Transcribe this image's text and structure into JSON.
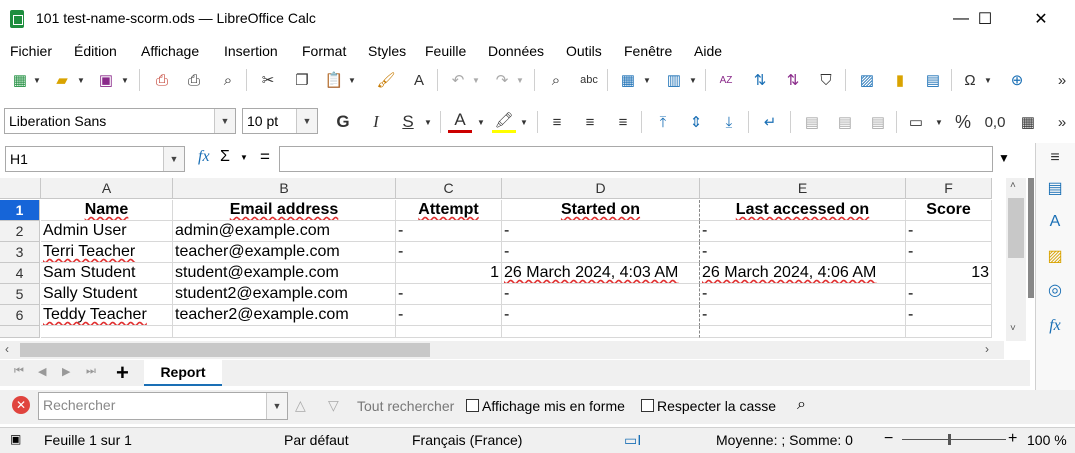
{
  "window": {
    "title": "101 test-name-scorm.ods — LibreOffice Calc",
    "minimize": "—",
    "maximize": "☐",
    "close": "✕"
  },
  "menu": [
    "Fichier",
    "Édition",
    "Affichage",
    "Insertion",
    "Format",
    "Styles",
    "Feuille",
    "Données",
    "Outils",
    "Fenêtre",
    "Aide"
  ],
  "formatting": {
    "font_name": "Liberation Sans",
    "font_size": "10 pt"
  },
  "formula_bar": {
    "name_box": "H1",
    "fx": "fx",
    "sigma": "Σ",
    "equals": "=",
    "content": ""
  },
  "sheet": {
    "columns": [
      "A",
      "B",
      "C",
      "D",
      "E",
      "F"
    ],
    "rows": [
      "1",
      "2",
      "3",
      "4",
      "5",
      "6"
    ],
    "headers": [
      "Name",
      "Email address",
      "Attempt",
      "Started on",
      "Last accessed on",
      "Score"
    ],
    "data": [
      [
        "Admin User",
        "admin@example.com",
        "-",
        "-",
        "-",
        "-"
      ],
      [
        "Terri Teacher",
        "teacher@example.com",
        "-",
        "-",
        "-",
        "-"
      ],
      [
        "Sam Student",
        "student@example.com",
        "1",
        "26 March 2024, 4:03 AM",
        "26 March 2024, 4:06 AM",
        "13"
      ],
      [
        "Sally Student",
        "student2@example.com",
        "-",
        "-",
        "-",
        "-"
      ],
      [
        "Teddy Teacher",
        "teacher2@example.com",
        "-",
        "-",
        "-",
        "-"
      ]
    ]
  },
  "tabs": {
    "add": "+",
    "active_tab": "Report"
  },
  "find": {
    "placeholder": "Rechercher",
    "find_all": "Tout rechercher",
    "formatted_display": "Affichage mis en forme",
    "match_case": "Respecter la casse"
  },
  "status": {
    "sheet": "Feuille 1 sur 1",
    "page_style": "Par défaut",
    "language": "Français (France)",
    "summary": "Moyenne: ; Somme: 0",
    "zoom_minus": "−",
    "zoom_plus": "+",
    "zoom": "100 %"
  }
}
